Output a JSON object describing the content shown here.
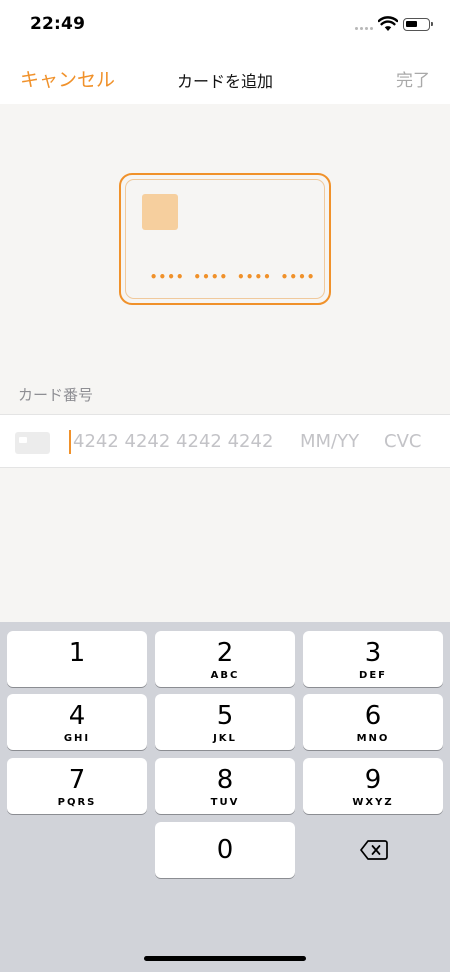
{
  "status": {
    "time": "22:49"
  },
  "nav": {
    "cancel_label": "キャンセル",
    "title": "カードを追加",
    "done_label": "完了"
  },
  "card_illustration": {
    "masked_number": "•••• •••• •••• ••••"
  },
  "form": {
    "section_label": "カード番号",
    "number_placeholder": "4242 4242 4242 4242",
    "expiry_placeholder": "MM/YY",
    "cvc_placeholder": "CVC"
  },
  "keyboard": {
    "keys": [
      {
        "digit": "1",
        "letters": ""
      },
      {
        "digit": "2",
        "letters": "ABC"
      },
      {
        "digit": "3",
        "letters": "DEF"
      },
      {
        "digit": "4",
        "letters": "GHI"
      },
      {
        "digit": "5",
        "letters": "JKL"
      },
      {
        "digit": "6",
        "letters": "MNO"
      },
      {
        "digit": "7",
        "letters": "PQRS"
      },
      {
        "digit": "8",
        "letters": "TUV"
      },
      {
        "digit": "9",
        "letters": "WXYZ"
      },
      {
        "digit": "0",
        "letters": ""
      }
    ],
    "delete_icon": "delete-backspace-icon"
  },
  "colors": {
    "accent": "#f0912a",
    "placeholder": "#c3c3c7",
    "keyboard_bg": "#d1d3d9"
  }
}
